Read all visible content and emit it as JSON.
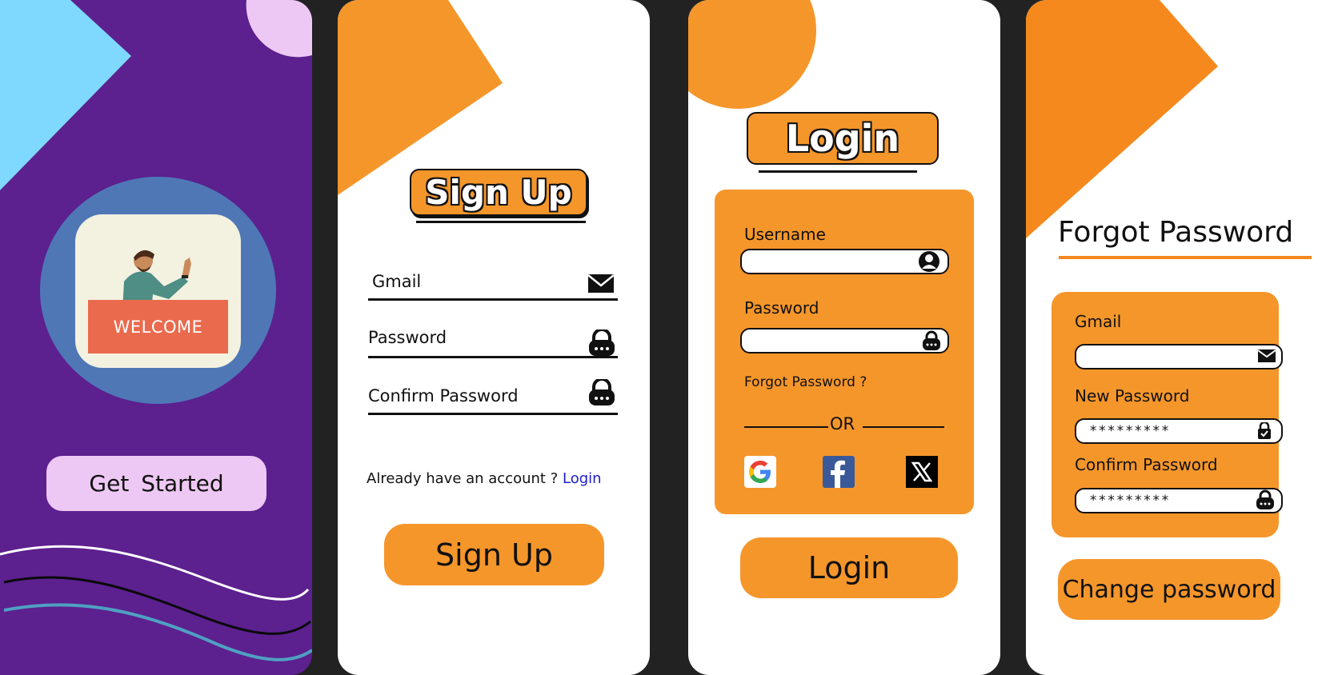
{
  "welcome_screen": {
    "sign_text": "WELCOME",
    "get_started_label": "Get  Started"
  },
  "signup_screen": {
    "title": "Sign Up",
    "gmail_label": "Gmail",
    "password_label": "Password",
    "confirm_password_label": "Confirm Password",
    "account_prompt": "Already have an account ?",
    "login_link": "Login",
    "signup_button": "Sign Up"
  },
  "login_screen": {
    "title": "Login",
    "username_label": "Username",
    "password_label": "Password",
    "forgot_link": "Forgot Password ?",
    "or_text": "OR",
    "login_button": "Login",
    "social": [
      "google-icon",
      "facebook-icon",
      "x-icon"
    ]
  },
  "forgot_screen": {
    "title": "Forgot Password",
    "gmail_label": "Gmail",
    "new_password_label": "New Password",
    "new_password_value": "*********",
    "confirm_password_label": "Confirm Password",
    "confirm_password_value": "*********",
    "change_button": "Change password"
  },
  "colors": {
    "background": "#222222",
    "purple": "#5c208f",
    "orange": "#f5962b",
    "light_blue": "#7fd9ff",
    "lilac": "#eec8f4",
    "circle_blue": "#4f77b6",
    "welcome_red": "#ea6a4d",
    "link_blue": "#1e1ecf"
  }
}
